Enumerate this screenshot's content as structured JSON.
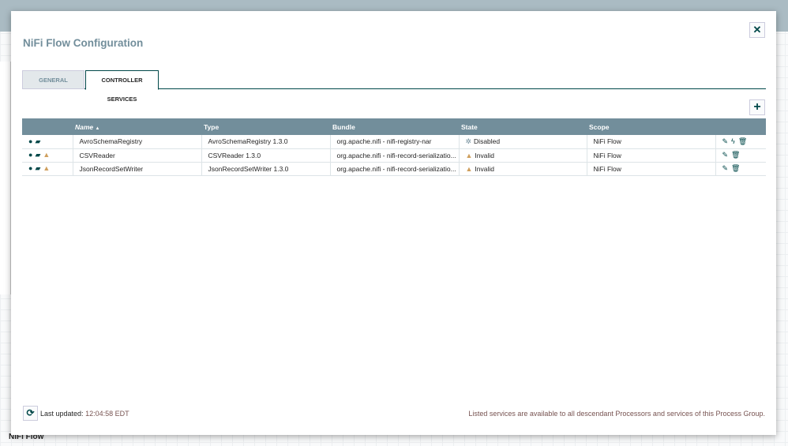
{
  "dialog": {
    "title": "NiFi Flow Configuration",
    "close_icon": "close-icon"
  },
  "tabs": [
    {
      "label": "GENERAL"
    },
    {
      "label": "CONTROLLER SERVICES"
    }
  ],
  "table": {
    "headers": [
      "",
      "Name",
      "Type",
      "Bundle",
      "State",
      "Scope",
      ""
    ],
    "sort_indicator": "▲",
    "rows": [
      {
        "name": "AvroSchemaRegistry",
        "type": "AvroSchemaRegistry 1.3.0",
        "bundle": "org.apache.nifi - nifi-registry-nar",
        "state": "Disabled",
        "scope": "NiFi Flow",
        "warning": false,
        "enable": true
      },
      {
        "name": "CSVReader",
        "type": "CSVReader 1.3.0",
        "bundle": "org.apache.nifi - nifi-record-serializatio...",
        "state": "Invalid",
        "scope": "NiFi Flow",
        "warning": true,
        "enable": false
      },
      {
        "name": "JsonRecordSetWriter",
        "type": "JsonRecordSetWriter 1.3.0",
        "bundle": "org.apache.nifi - nifi-record-serializatio...",
        "state": "Invalid",
        "scope": "NiFi Flow",
        "warning": true,
        "enable": false
      }
    ]
  },
  "footer": {
    "last_updated_label": "Last updated:",
    "last_updated_value": "12:04:58 EDT",
    "note": "Listed services are available to all descendant Processors and services of this Process Group."
  },
  "breadcrumb": "NiFi Flow",
  "colors": {
    "header": "#728e9b",
    "accent": "#004849",
    "warning": "#cf9f5d"
  }
}
